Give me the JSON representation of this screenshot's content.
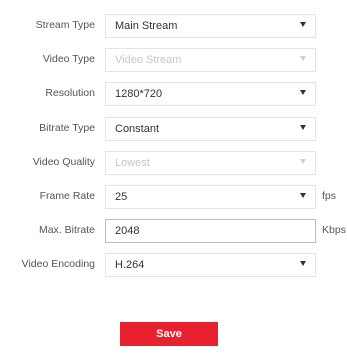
{
  "form": {
    "stream_type": {
      "label": "Stream Type",
      "value": "Main Stream"
    },
    "video_type": {
      "label": "Video Type",
      "value": "Video Stream"
    },
    "resolution": {
      "label": "Resolution",
      "value": "1280*720"
    },
    "bitrate_type": {
      "label": "Bitrate Type",
      "value": "Constant"
    },
    "video_quality": {
      "label": "Video Quality",
      "value": "Lowest"
    },
    "frame_rate": {
      "label": "Frame Rate",
      "value": "25",
      "unit": "fps"
    },
    "max_bitrate": {
      "label": "Max. Bitrate",
      "value": "2048",
      "unit": "Kbps"
    },
    "video_encoding": {
      "label": "Video Encoding",
      "value": "H.264"
    }
  },
  "actions": {
    "save_label": "Save"
  },
  "colors": {
    "accent": "#e8212e",
    "disabled_text": "#c6c6c6"
  },
  "icons": {
    "dropdown": "caret-down-icon"
  }
}
